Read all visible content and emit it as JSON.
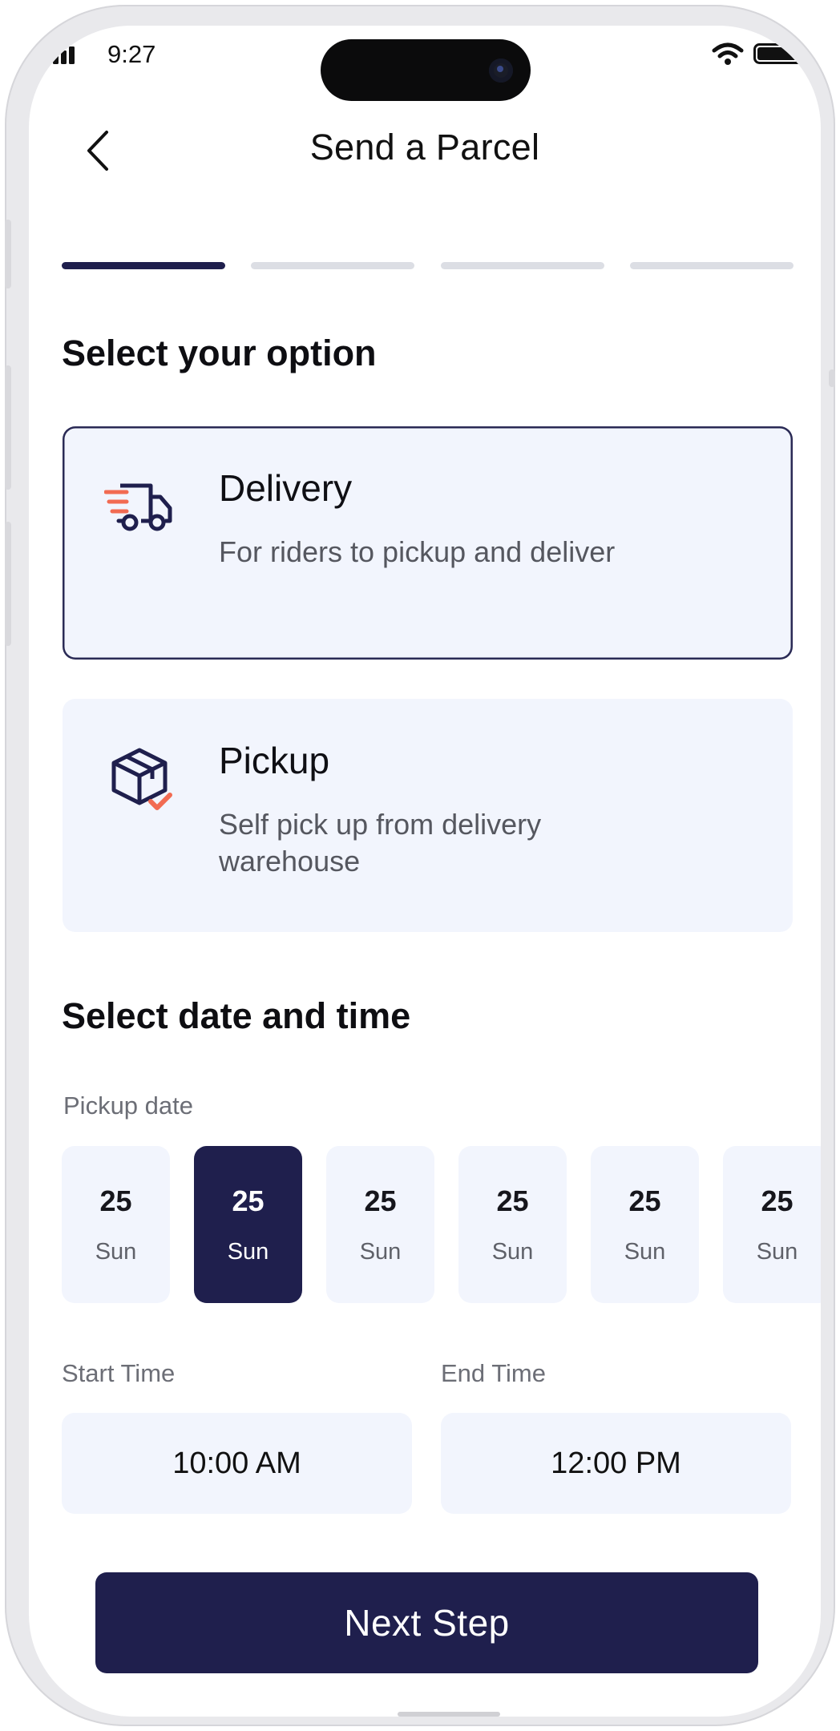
{
  "status_bar": {
    "time": "9:27"
  },
  "header": {
    "title": "Send a Parcel"
  },
  "stepper": {
    "total_steps": 4,
    "current_step": 1
  },
  "options_section": {
    "title": "Select your option",
    "options": [
      {
        "title": "Delivery",
        "description": "For riders to pickup and deliver",
        "icon": "delivery-truck-icon",
        "selected": true
      },
      {
        "title": "Pickup",
        "description": "Self pick up from delivery warehouse",
        "icon": "package-check-icon",
        "selected": false
      }
    ]
  },
  "schedule_section": {
    "title": "Select date and time",
    "pickup_date_label": "Pickup date",
    "dates": [
      {
        "num": "25",
        "day": "Sun",
        "selected": false
      },
      {
        "num": "25",
        "day": "Sun",
        "selected": true
      },
      {
        "num": "25",
        "day": "Sun",
        "selected": false
      },
      {
        "num": "25",
        "day": "Sun",
        "selected": false
      },
      {
        "num": "25",
        "day": "Sun",
        "selected": false
      },
      {
        "num": "25",
        "day": "Sun",
        "selected": false
      }
    ],
    "start_time_label": "Start Time",
    "start_time_value": "10:00 AM",
    "end_time_label": "End Time",
    "end_time_value": "12:00 PM"
  },
  "footer": {
    "next_label": "Next Step"
  },
  "colors": {
    "primary": "#1f1f4d",
    "card_bg": "#f2f5fd",
    "accent": "#f26b52"
  }
}
